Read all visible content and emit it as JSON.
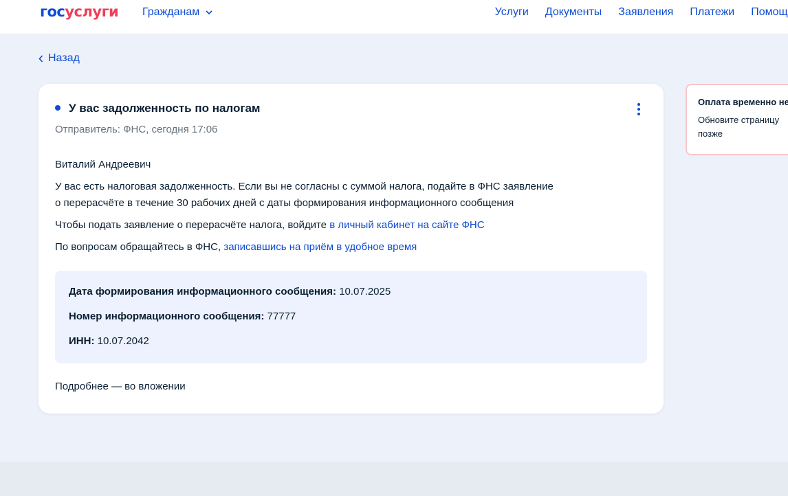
{
  "header": {
    "logo": {
      "part1": "гос",
      "part2": "услуги"
    },
    "audience": "Гражданам",
    "nav": [
      "Услуги",
      "Документы",
      "Заявления",
      "Платежи",
      "Помощь"
    ]
  },
  "back_label": "Назад",
  "message": {
    "title": "У вас задолженность по налогам",
    "sender": "Отправитель: ФНС, сегодня 17:06",
    "greeting": "Виталий Андреевич",
    "para1_line1": "У вас есть налоговая задолженность. Если вы не согласны с суммой налога, подайте в ФНС заявление",
    "para1_line2": "о перерасчёте в течение 30 рабочих дней с даты формирования информационного сообщения",
    "para2_text": "Чтобы подать заявление о перерасчёте налога, войдите ",
    "para2_link": "в личный кабинет на сайте ФНС",
    "para3_text": "По вопросам обращайтесь в ФНС, ",
    "para3_link": "записавшись на приём в удобное время",
    "info": {
      "date_label": "Дата формирования информационного сообщения:",
      "date_value": "10.07.2025",
      "number_label": "Номер информационного сообщения:",
      "number_value": "77777",
      "inn_label": "ИНН:",
      "inn_value": "10.07.2042"
    },
    "footer": "Подробнее — во вложении"
  },
  "notice": {
    "title": "Оплата временно не",
    "text": "Обновите страницу позже"
  },
  "colors": {
    "brand_blue": "#0d4cd3",
    "brand_red": "#ee3f58",
    "page_bg": "#edf2fa",
    "info_bg": "#edf2fe",
    "notice_border": "#f6c6cd"
  }
}
